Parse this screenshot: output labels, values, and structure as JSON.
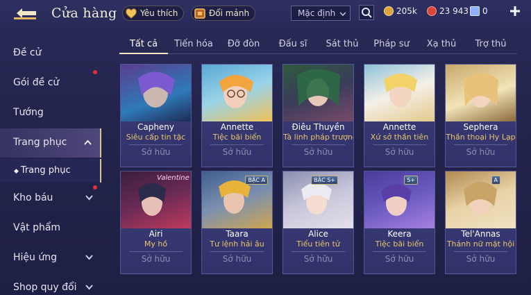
{
  "header": {
    "title": "Cửa hàng",
    "favorites_label": "Yêu thích",
    "exchange_label": "Đổi mảnh",
    "sort_value": "Mặc định",
    "currencies": [
      {
        "label": "205k",
        "color": "#d9a441"
      },
      {
        "label": "23 943",
        "color": "#d9463f"
      },
      {
        "label": "0",
        "color": "#8fb0ff"
      }
    ]
  },
  "sidebar": {
    "items": [
      {
        "label": "Đề cử"
      },
      {
        "label": "Gói đề cử"
      },
      {
        "label": "Tướng"
      },
      {
        "label": "Trang phục"
      },
      {
        "label": "Kho báu"
      },
      {
        "label": "Vật phẩm"
      },
      {
        "label": "Hiệu ứng"
      },
      {
        "label": "Shop quy đổi"
      }
    ],
    "subitem": {
      "label": "Trang phục"
    }
  },
  "tabs": [
    {
      "label": "Tất cả"
    },
    {
      "label": "Tiến hóa"
    },
    {
      "label": "Đỡ đòn"
    },
    {
      "label": "Đấu sĩ"
    },
    {
      "label": "Sát thủ"
    },
    {
      "label": "Pháp sư"
    },
    {
      "label": "Xạ thủ"
    },
    {
      "label": "Trợ thủ"
    }
  ],
  "cards": [
    {
      "hero": "Capheny",
      "skin": "Siêu cấp tin tặc",
      "status": "Sở hữu",
      "colors": [
        "#5a3d8f",
        "#2f7ab8"
      ]
    },
    {
      "hero": "Annette",
      "skin": "Tiệc bãi biển",
      "status": "Sở hữu",
      "colors": [
        "#58a8d6",
        "#f0c25a"
      ]
    },
    {
      "hero": "Điêu Thuyền",
      "skin": "Tà linh pháp trượng",
      "status": "Sở hữu",
      "colors": [
        "#2f5a3e",
        "#7a4a6a"
      ]
    },
    {
      "hero": "Annette",
      "skin": "Xứ sở thần tiên",
      "status": "Sở hữu",
      "colors": [
        "#8fc1d8",
        "#e3c88a"
      ]
    },
    {
      "hero": "Sephera",
      "skin": "Thần thoại Hy Lạp",
      "status": "Sở hữu",
      "colors": [
        "#c9a86a",
        "#f1e3b8"
      ]
    },
    {
      "hero": "Airi",
      "skin": "My hồ",
      "status": "Sở hữu",
      "colors": [
        "#3b1e3e",
        "#c03a5c"
      ],
      "art_text": "Valentine"
    },
    {
      "hero": "Taara",
      "skin": "Tư lệnh hải âu",
      "status": "Sở hữu",
      "colors": [
        "#3f5f8f",
        "#cfa650"
      ],
      "badge": "BẬC A"
    },
    {
      "hero": "Alice",
      "skin": "Tiểu tiên tử",
      "status": "Sở hữu",
      "colors": [
        "#8a8fb0",
        "#e4e0ea"
      ],
      "badge": "BẬC S+"
    },
    {
      "hero": "Keera",
      "skin": "Tiệc bãi biển",
      "status": "Sở hữu",
      "colors": [
        "#4a3a9a",
        "#a680e0"
      ],
      "badge": "S+"
    },
    {
      "hero": "Tel'Annas",
      "skin": "Thánh nữ mặt hội",
      "status": "Sở hữu",
      "colors": [
        "#b08a50",
        "#f0e2c0"
      ],
      "badge": "A"
    }
  ]
}
